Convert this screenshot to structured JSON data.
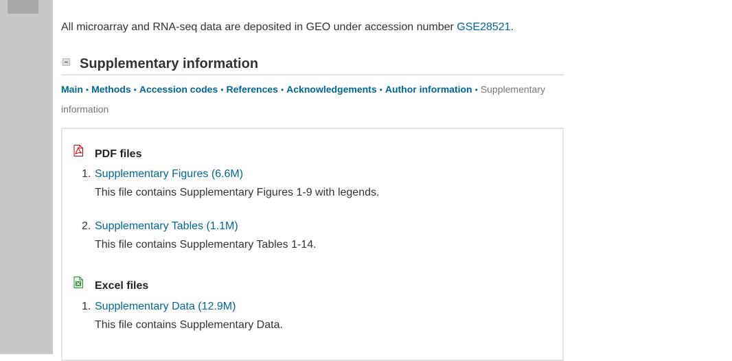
{
  "intro": {
    "text": "All microarray and RNA-seq data are deposited in GEO under accession number ",
    "accession_link": "GSE28521",
    "trailing": "."
  },
  "section": {
    "title": "Supplementary information"
  },
  "jump_nav": {
    "items": [
      "Main",
      "Methods",
      "Accession codes",
      "References",
      "Acknowledgements",
      "Author information"
    ],
    "separator": "•",
    "current": "Supplementary information"
  },
  "groups": [
    {
      "title": "PDF files",
      "icon": "pdf-icon",
      "files": [
        {
          "num": "1.",
          "link": "Supplementary Figures (6.6M)",
          "desc": "This file contains Supplementary Figures 1-9 with legends."
        },
        {
          "num": "2.",
          "link": "Supplementary Tables (1.1M)",
          "desc": "This file contains Supplementary Tables 1-14."
        }
      ]
    },
    {
      "title": "Excel files",
      "icon": "excel-icon",
      "files": [
        {
          "num": "1.",
          "link": "Supplementary Data (12.9M)",
          "desc": "This file contains Supplementary Data."
        }
      ]
    }
  ],
  "colors": {
    "link": "#006699",
    "rail": "#c8c8c8",
    "pdf_icon": "#cc0000",
    "excel_icon": "#2e8b2e"
  }
}
